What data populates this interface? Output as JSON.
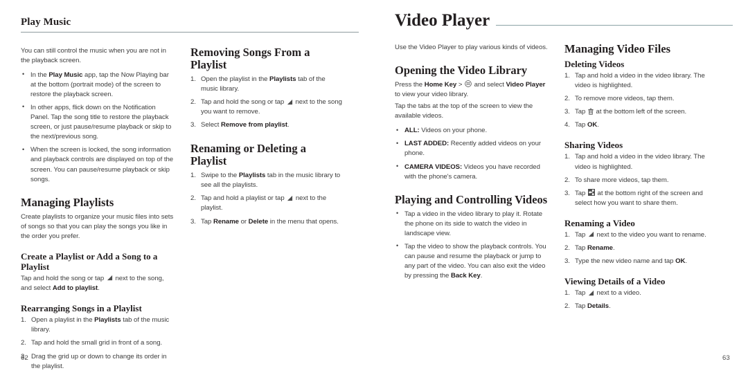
{
  "document": {
    "type": "user-manual-spread",
    "rule_color": "#8e9b9d",
    "accent_rule_color": "#8ba3a6",
    "body_text_color": "#3c3c3c"
  },
  "left_page": {
    "page_number": "62",
    "header": "Play Music",
    "col1": {
      "intro": "You can still control the music when you are not in the playback screen.",
      "bullets": [
        {
          "parts": [
            {
              "t": "In the ",
              "b": false
            },
            {
              "t": "Play Music",
              "b": true
            },
            {
              "t": " app, tap the Now Playing bar at the bottom (portrait mode) of the screen to restore the playback screen.",
              "b": false
            }
          ]
        },
        {
          "parts": [
            {
              "t": "In other apps, flick down on the Notification Panel. Tap the song title to restore the playback screen, or just pause/resume playback or skip to the next/previous song.",
              "b": false
            }
          ]
        },
        {
          "parts": [
            {
              "t": "When the screen is locked, the song information and playback controls are displayed on top of the screen. You can pause/resume playback or skip songs.",
              "b": false
            }
          ]
        }
      ],
      "h2_managing_playlists": "Managing Playlists",
      "managing_playlists_body": "Create playlists to organize your music files into sets of songs so that you can play the songs you like in the order you prefer.",
      "h3_create_playlist": "Create a Playlist or Add a Song to a Playlist",
      "create_playlist_body": [
        {
          "t": "Tap and hold the song or tap ",
          "b": false
        },
        {
          "icon": "menu-triangle-icon"
        },
        {
          "t": " next to the song, and select ",
          "b": false
        },
        {
          "t": "Add to playlist",
          "b": true
        },
        {
          "t": ".",
          "b": false
        }
      ],
      "h3_rearranging": "Rearranging Songs in a Playlist",
      "rearranging_steps": [
        [
          {
            "t": "Open a playlist in the ",
            "b": false
          },
          {
            "t": "Playlists",
            "b": true
          },
          {
            "t": " tab of the music library.",
            "b": false
          }
        ],
        [
          {
            "t": "Tap and hold the small grid in front of a song.",
            "b": false
          }
        ],
        [
          {
            "t": "Drag the grid up or down to change its order in the playlist.",
            "b": false
          }
        ]
      ]
    },
    "col2": {
      "h2_removing": "Removing Songs From a Playlist",
      "removing_steps": [
        [
          {
            "t": "Open the playlist in the ",
            "b": false
          },
          {
            "t": "Playlists",
            "b": true
          },
          {
            "t": " tab of the music library.",
            "b": false
          }
        ],
        [
          {
            "t": "Tap and hold the song or tap ",
            "b": false
          },
          {
            "icon": "menu-triangle-icon"
          },
          {
            "t": " next to the song you want to remove.",
            "b": false
          }
        ],
        [
          {
            "t": "Select ",
            "b": false
          },
          {
            "t": "Remove from playlist",
            "b": true
          },
          {
            "t": ".",
            "b": false
          }
        ]
      ],
      "h2_renaming": "Renaming or Deleting a Playlist",
      "renaming_steps": [
        [
          {
            "t": "Swipe to the ",
            "b": false
          },
          {
            "t": "Playlists",
            "b": true
          },
          {
            "t": " tab in the music library to see all the playlists.",
            "b": false
          }
        ],
        [
          {
            "t": "Tap and hold a playlist or tap ",
            "b": false
          },
          {
            "icon": "menu-triangle-icon"
          },
          {
            "t": " next to the playlist.",
            "b": false
          }
        ],
        [
          {
            "t": "Tap ",
            "b": false
          },
          {
            "t": "Rename",
            "b": true
          },
          {
            "t": " or ",
            "b": false
          },
          {
            "t": "Delete",
            "b": true
          },
          {
            "t": " in the menu that opens.",
            "b": false
          }
        ]
      ]
    }
  },
  "right_page": {
    "page_number": "63",
    "header": "Video Player",
    "col1": {
      "intro": "Use the Video Player to play various kinds of videos.",
      "h2_opening": "Opening the Video Library",
      "opening_body": [
        {
          "t": "Press the ",
          "b": false
        },
        {
          "t": "Home Key",
          "b": true
        },
        {
          "t": " > ",
          "b": false
        },
        {
          "icon": "app-drawer-icon"
        },
        {
          "t": " and select ",
          "b": false
        },
        {
          "t": "Video Player",
          "b": true
        },
        {
          "t": " to view your video library.",
          "b": false
        }
      ],
      "tabs_body": "Tap the tabs at the top of the screen to view the available videos.",
      "tab_bullets": [
        [
          {
            "t": "ALL:",
            "b": true
          },
          {
            "t": " Videos on your phone.",
            "b": false
          }
        ],
        [
          {
            "t": "LAST ADDED:",
            "b": true
          },
          {
            "t": " Recently added videos on your phone.",
            "b": false
          }
        ],
        [
          {
            "t": "CAMERA VIDEOS:",
            "b": true
          },
          {
            "t": " Videos you have recorded with the phone's camera.",
            "b": false
          }
        ]
      ],
      "h2_playing": "Playing and Controlling Videos",
      "playing_bullets": [
        [
          {
            "t": "Tap a video in the video library to play it. Rotate the phone on its side to watch the video in landscape view.",
            "b": false
          }
        ],
        [
          {
            "t": "Tap the video to show the playback controls. You can pause and resume the playback or jump to any part of the video. You can also exit the video by pressing the ",
            "b": false
          },
          {
            "t": "Back Key",
            "b": true
          },
          {
            "t": ".",
            "b": false
          }
        ]
      ]
    },
    "col2": {
      "h2_managing": "Managing Video Files",
      "h3_deleting": "Deleting Videos",
      "deleting_steps": [
        [
          {
            "t": "Tap and hold a video in the video library. The video is highlighted.",
            "b": false
          }
        ],
        [
          {
            "t": "To remove more videos, tap them.",
            "b": false
          }
        ],
        [
          {
            "t": "Tap ",
            "b": false
          },
          {
            "icon": "trash-icon"
          },
          {
            "t": " at the bottom left of the screen.",
            "b": false
          }
        ],
        [
          {
            "t": "Tap ",
            "b": false
          },
          {
            "t": "OK",
            "b": true
          },
          {
            "t": ".",
            "b": false
          }
        ]
      ],
      "h3_sharing": "Sharing Videos",
      "sharing_steps": [
        [
          {
            "t": "Tap and hold a video in the video library. The video is highlighted.",
            "b": false
          }
        ],
        [
          {
            "t": "To share more videos, tap them.",
            "b": false
          }
        ],
        [
          {
            "t": "Tap ",
            "b": false
          },
          {
            "icon": "share-icon"
          },
          {
            "t": " at the bottom right of the screen and select how you want to share them.",
            "b": false
          }
        ]
      ],
      "h3_renaming": "Renaming a Video",
      "renaming_steps": [
        [
          {
            "t": "Tap ",
            "b": false
          },
          {
            "icon": "menu-triangle-icon"
          },
          {
            "t": " next to the video you want to rename.",
            "b": false
          }
        ],
        [
          {
            "t": "Tap ",
            "b": false
          },
          {
            "t": "Rename",
            "b": true
          },
          {
            "t": ".",
            "b": false
          }
        ],
        [
          {
            "t": "Type the new video name and tap ",
            "b": false
          },
          {
            "t": "OK",
            "b": true
          },
          {
            "t": ".",
            "b": false
          }
        ]
      ],
      "h3_viewing": "Viewing Details of a Video",
      "viewing_steps": [
        [
          {
            "t": "Tap ",
            "b": false
          },
          {
            "icon": "menu-triangle-icon"
          },
          {
            "t": " next to a video.",
            "b": false
          }
        ],
        [
          {
            "t": "Tap ",
            "b": false
          },
          {
            "t": "Details",
            "b": true
          },
          {
            "t": ".",
            "b": false
          }
        ]
      ]
    }
  }
}
